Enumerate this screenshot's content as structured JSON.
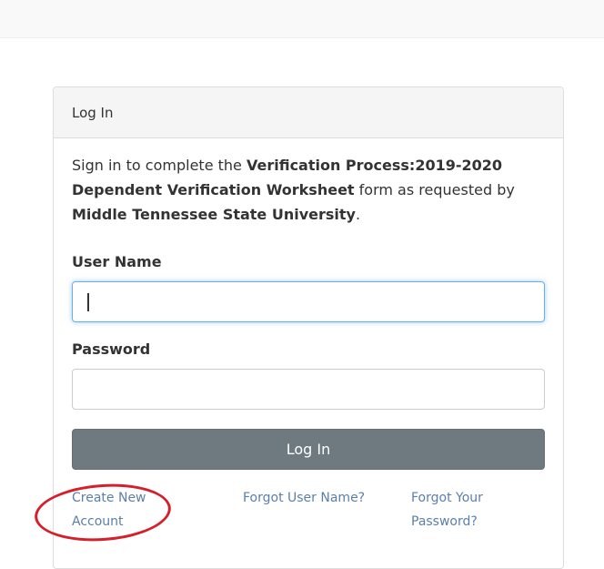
{
  "panel": {
    "heading": "Log In",
    "intro": {
      "text1": "Sign in to complete the ",
      "bold1": "Verification Process:2019-2020 Dependent Verification Worksheet",
      "text2": " form as requested by ",
      "bold2": "Middle Tennessee State University",
      "text3": "."
    }
  },
  "form": {
    "username_label": "User Name",
    "username_value": "",
    "password_label": "Password",
    "password_value": "",
    "login_button": "Log In"
  },
  "links": {
    "create_account": "Create New Account",
    "forgot_username": "Forgot User Name?",
    "forgot_password": "Forgot Your Password?"
  },
  "colors": {
    "button_bg": "#6f7a80",
    "link": "#5b7fa8",
    "focus_border": "#66afe9",
    "annotation": "#d4202a"
  }
}
